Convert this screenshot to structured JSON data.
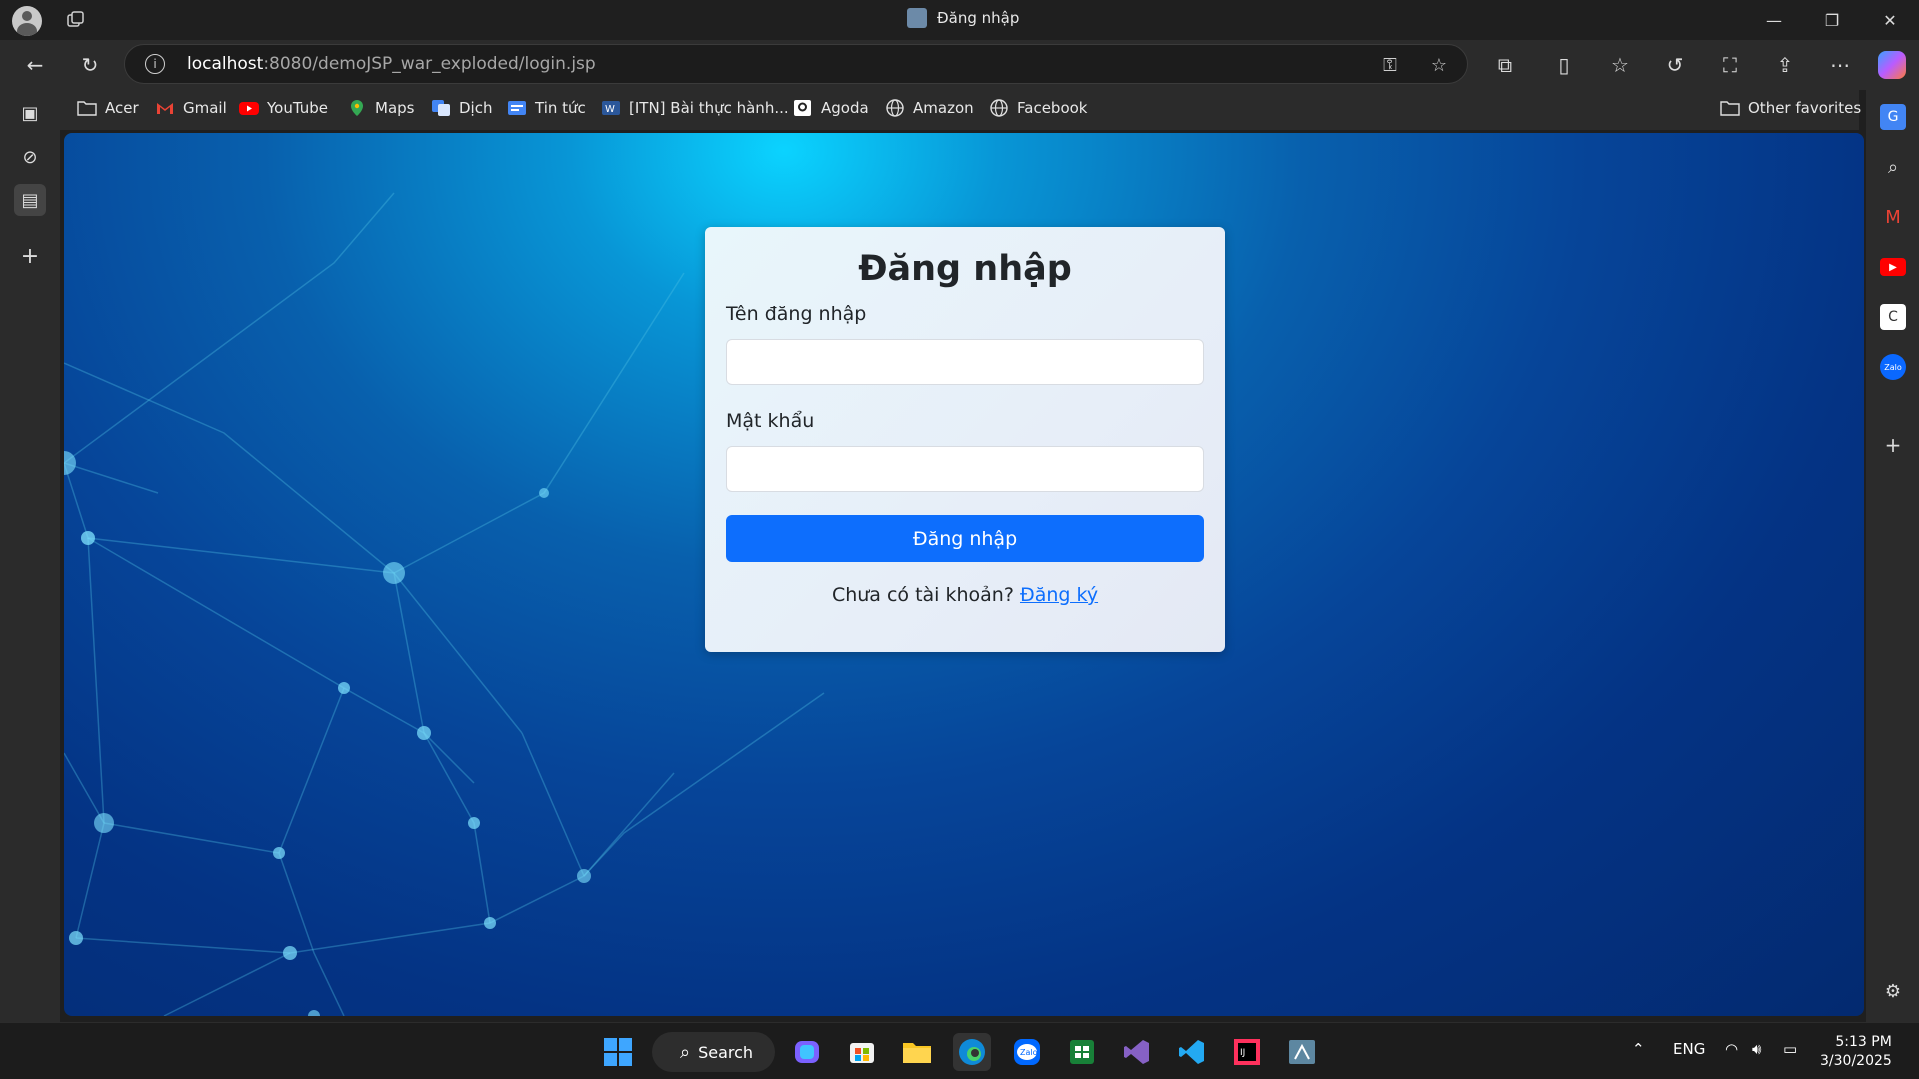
{
  "window": {
    "tab_title": "Đăng nhập",
    "controls": {
      "minimize": "—",
      "restore": "❐",
      "close": "✕"
    }
  },
  "address_bar": {
    "url_host": "localhost",
    "url_rest": ":8080/demoJSP_war_exploded/login.jsp"
  },
  "favorites": [
    {
      "label": "Acer",
      "icon": "folder-icon"
    },
    {
      "label": "Gmail",
      "icon": "gmail-icon"
    },
    {
      "label": "YouTube",
      "icon": "youtube-icon"
    },
    {
      "label": "Maps",
      "icon": "maps-icon"
    },
    {
      "label": "Dịch",
      "icon": "translate-icon"
    },
    {
      "label": "Tin tức",
      "icon": "news-icon"
    },
    {
      "label": "[ITN] Bài thực hành...",
      "icon": "word-icon"
    },
    {
      "label": "Agoda",
      "icon": "agoda-icon"
    },
    {
      "label": "Amazon",
      "icon": "globe-icon"
    },
    {
      "label": "Facebook",
      "icon": "globe-icon"
    }
  ],
  "other_favorites": "Other favorites",
  "login": {
    "title": "Đăng nhập",
    "username_label": "Tên đăng nhập",
    "username_value": "",
    "password_label": "Mật khẩu",
    "password_value": "",
    "submit_label": "Đăng nhập",
    "signup_prompt": "Chưa có tài khoản?",
    "signup_link": "Đăng ký"
  },
  "taskbar": {
    "search_label": "Search",
    "language": "ENG",
    "time": "5:13 PM",
    "date": "3/30/2025"
  },
  "colors": {
    "primary": "#0d6efd",
    "background_start": "#0bd3ff",
    "background_end": "#032a70"
  }
}
